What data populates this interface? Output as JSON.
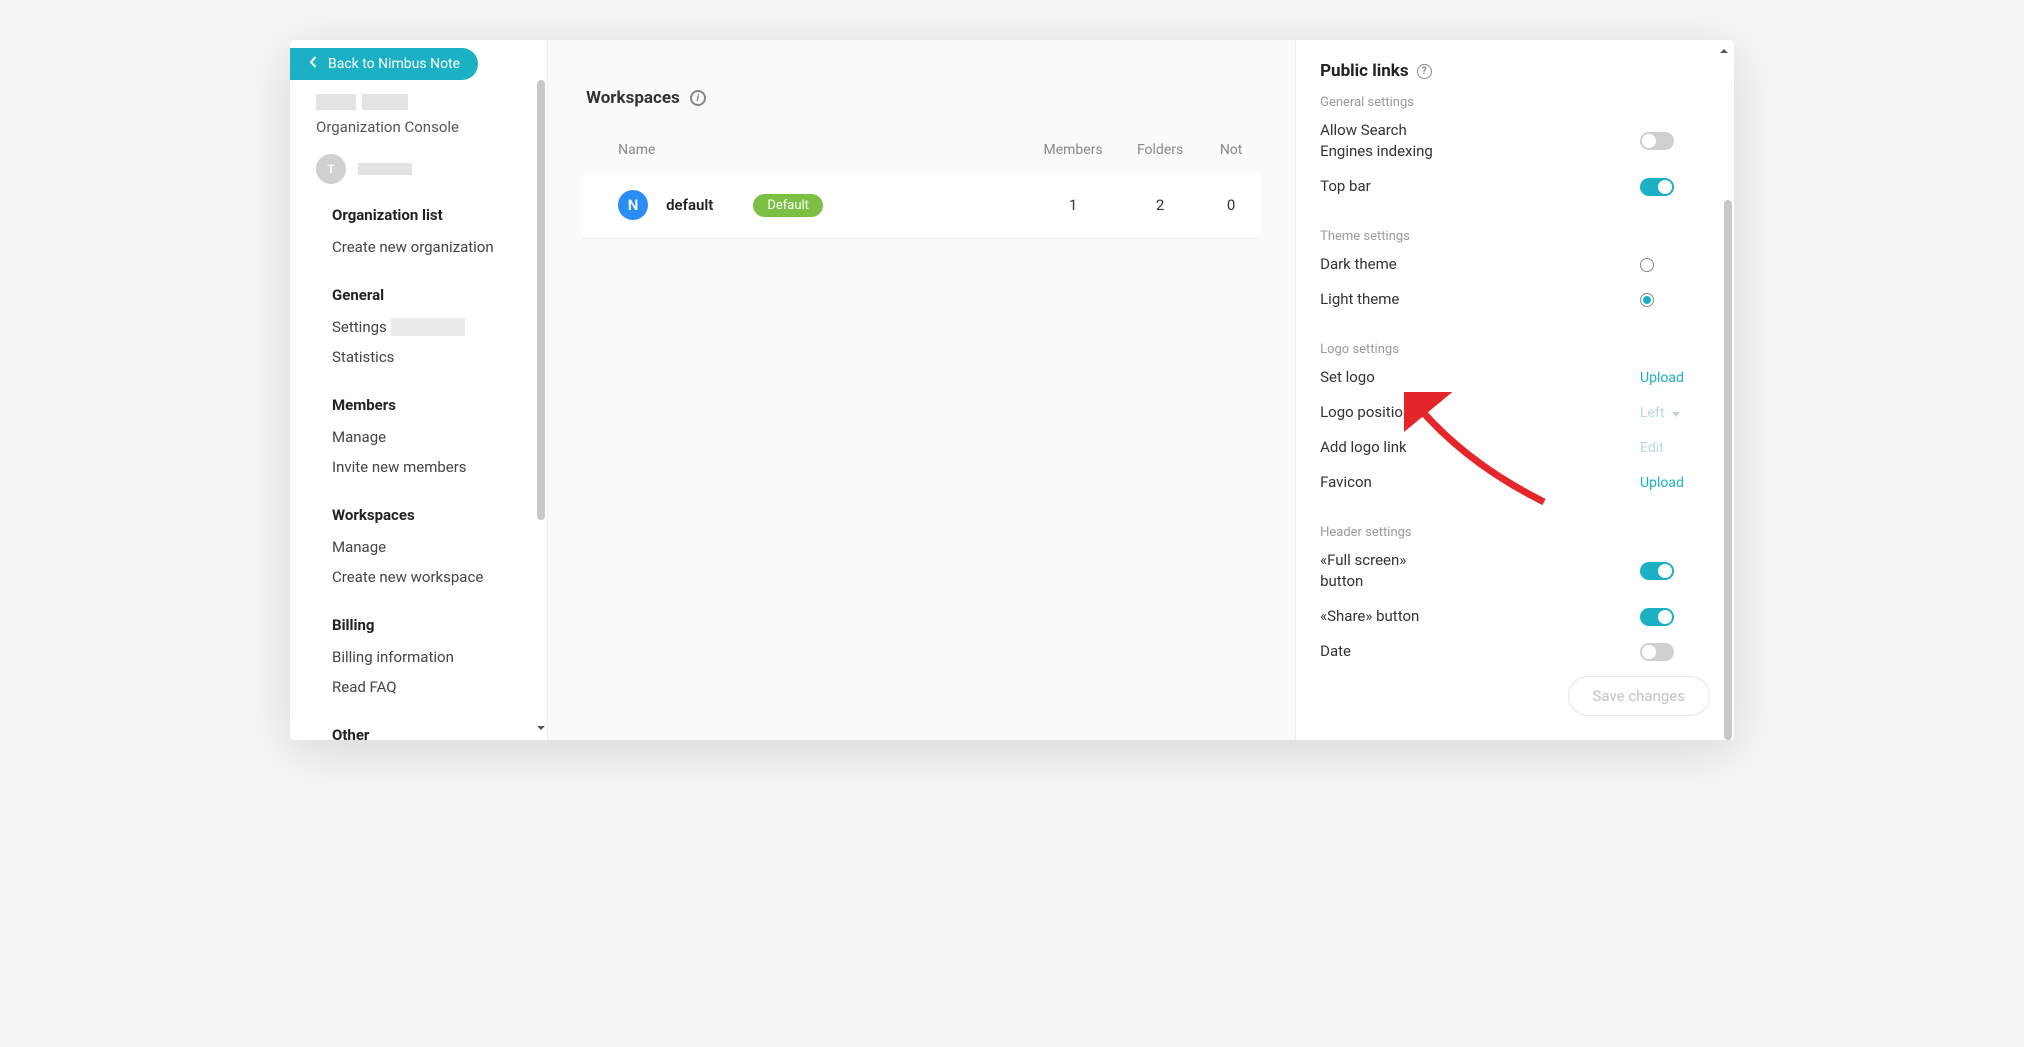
{
  "back_button": "Back to Nimbus Note",
  "org_console_label": "Organization Console",
  "avatar_initial": "T",
  "sidebar": {
    "groups": [
      {
        "heading": "",
        "items": [
          "Organization list",
          "Create new organization"
        ]
      },
      {
        "heading": "General",
        "items": [
          "Settings",
          "Statistics"
        ]
      },
      {
        "heading": "Members",
        "items": [
          "Manage",
          "Invite new members"
        ]
      },
      {
        "heading": "Workspaces",
        "items": [
          "Manage",
          "Create new workspace"
        ]
      },
      {
        "heading": "Billing",
        "items": [
          "Billing information",
          "Read FAQ"
        ]
      },
      {
        "heading": "Other",
        "items": []
      }
    ]
  },
  "main": {
    "title": "Workspaces",
    "columns": {
      "name": "Name",
      "members": "Members",
      "folders": "Folders",
      "notes": "Not"
    },
    "rows": [
      {
        "icon_letter": "N",
        "name": "default",
        "badge": "Default",
        "members": "1",
        "folders": "2",
        "notes": "0"
      }
    ]
  },
  "panel": {
    "title": "Public links",
    "sections": {
      "general": {
        "label": "General settings",
        "allow_search": {
          "label": "Allow Search Engines indexing",
          "on": false
        },
        "top_bar": {
          "label": "Top bar",
          "on": true
        }
      },
      "theme": {
        "label": "Theme settings",
        "dark": {
          "label": "Dark theme",
          "selected": false
        },
        "light": {
          "label": "Light theme",
          "selected": true
        }
      },
      "logo": {
        "label": "Logo settings",
        "set_logo": {
          "label": "Set logo",
          "action": "Upload"
        },
        "position": {
          "label": "Logo position",
          "value": "Left"
        },
        "add_link": {
          "label": "Add logo link",
          "action": "Edit"
        },
        "favicon": {
          "label": "Favicon",
          "action": "Upload"
        }
      },
      "header": {
        "label": "Header settings",
        "fullscreen": {
          "label": "«Full screen» button",
          "on": true
        },
        "share": {
          "label": "«Share» button",
          "on": true
        },
        "date": {
          "label": "Date",
          "on": false
        }
      }
    },
    "save_button": "Save changes"
  }
}
